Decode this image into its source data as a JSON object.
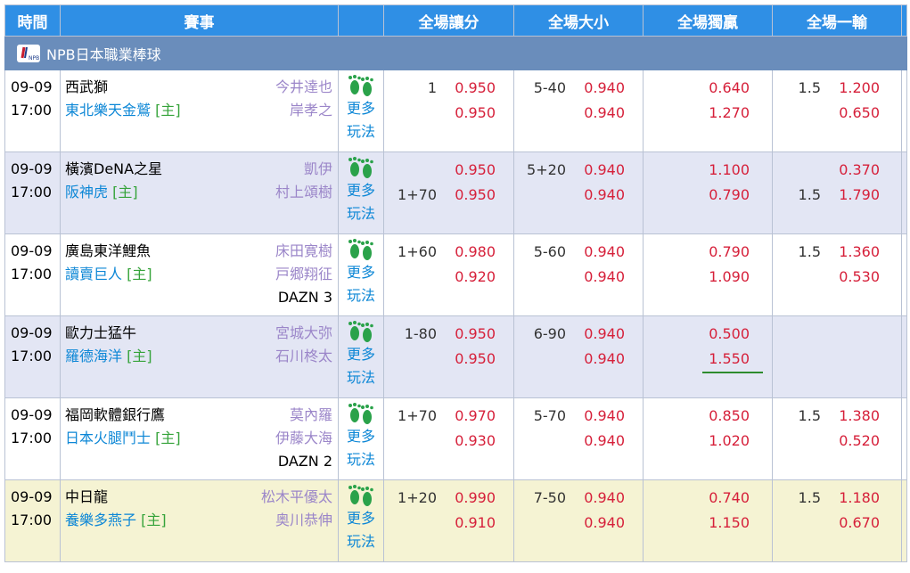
{
  "headers": {
    "time": "時間",
    "event": "賽事",
    "handicap": "全場讓分",
    "overunder": "全場大小",
    "moneyline": "全場獨贏",
    "onefive": "全場一輸"
  },
  "league": {
    "name": "NPB日本職業棒球",
    "logo_icon": "npb-logo-icon"
  },
  "colors": {
    "header_bg": "#2f8fe5",
    "league_bg": "#6a8dbb",
    "odds": "#d6203a",
    "home_team": "#0d87d6",
    "pitcher": "#9b86c9",
    "host_tag": "#35a33a"
  },
  "more_label_1": "更多",
  "more_label_2": "玩法",
  "more_icon": "footprints-icon",
  "matches": [
    {
      "date": "09-09",
      "time": "17:00",
      "away": "西武獅",
      "home": "東北樂天金鷲",
      "home_tag": "[主]",
      "away_pitcher": "今井達也",
      "home_pitcher": "岸孝之",
      "broadcast": "",
      "hdp": {
        "line1": "1",
        "val1": "0.950",
        "line2": "",
        "val2": "0.950"
      },
      "ou": {
        "line1": "5-40",
        "val1": "0.940",
        "line2": "",
        "val2": "0.940"
      },
      "ml": {
        "val1": "0.640",
        "val2": "1.270"
      },
      "rl": {
        "line1": "1.5",
        "val1": "1.200",
        "line2": "",
        "val2": "0.650"
      }
    },
    {
      "date": "09-09",
      "time": "17:00",
      "away": "橫濱DeNA之星",
      "home": "阪神虎",
      "home_tag": "[主]",
      "away_pitcher": "凱伊",
      "home_pitcher": "村上頌樹",
      "broadcast": "",
      "hdp": {
        "line1": "",
        "val1": "0.950",
        "line2": "1+70",
        "val2": "0.950"
      },
      "ou": {
        "line1": "5+20",
        "val1": "0.940",
        "line2": "",
        "val2": "0.940"
      },
      "ml": {
        "val1": "1.100",
        "val2": "0.790"
      },
      "rl": {
        "line1": "",
        "val1": "0.370",
        "line2": "1.5",
        "val2": "1.790"
      }
    },
    {
      "date": "09-09",
      "time": "17:00",
      "away": "廣島東洋鯉魚",
      "home": "讀賣巨人",
      "home_tag": "[主]",
      "away_pitcher": "床田寛樹",
      "home_pitcher": "戸郷翔征",
      "broadcast": "DAZN 3",
      "hdp": {
        "line1": "1+60",
        "val1": "0.980",
        "line2": "",
        "val2": "0.920"
      },
      "ou": {
        "line1": "5-60",
        "val1": "0.940",
        "line2": "",
        "val2": "0.940"
      },
      "ml": {
        "val1": "0.790",
        "val2": "1.090"
      },
      "rl": {
        "line1": "1.5",
        "val1": "1.360",
        "line2": "",
        "val2": "0.530"
      }
    },
    {
      "date": "09-09",
      "time": "17:00",
      "away": "歐力士猛牛",
      "home": "羅德海洋",
      "home_tag": "[主]",
      "away_pitcher": "宮城大弥",
      "home_pitcher": "石川柊太",
      "broadcast": "",
      "hdp": {
        "line1": "1-80",
        "val1": "0.950",
        "line2": "",
        "val2": "0.950"
      },
      "ou": {
        "line1": "6-90",
        "val1": "0.940",
        "line2": "",
        "val2": "0.940"
      },
      "ml": {
        "val1": "0.500",
        "val2": "1.550"
      },
      "rl": {
        "line1": "",
        "val1": "",
        "line2": "",
        "val2": ""
      }
    },
    {
      "date": "09-09",
      "time": "17:00",
      "away": "福岡軟體銀行鷹",
      "home": "日本火腿鬥士",
      "home_tag": "[主]",
      "away_pitcher": "莫內羅",
      "home_pitcher": "伊藤大海",
      "broadcast": "DAZN 2",
      "hdp": {
        "line1": "1+70",
        "val1": "0.970",
        "line2": "",
        "val2": "0.930"
      },
      "ou": {
        "line1": "5-70",
        "val1": "0.940",
        "line2": "",
        "val2": "0.940"
      },
      "ml": {
        "val1": "0.850",
        "val2": "1.020"
      },
      "rl": {
        "line1": "1.5",
        "val1": "1.380",
        "line2": "",
        "val2": "0.520"
      }
    },
    {
      "date": "09-09",
      "time": "17:00",
      "away": "中日龍",
      "home": "養樂多燕子",
      "home_tag": "[主]",
      "away_pitcher": "松木平優太",
      "home_pitcher": "奥川恭伸",
      "broadcast": "",
      "hdp": {
        "line1": "1+20",
        "val1": "0.990",
        "line2": "",
        "val2": "0.910"
      },
      "ou": {
        "line1": "7-50",
        "val1": "0.940",
        "line2": "",
        "val2": "0.940"
      },
      "ml": {
        "val1": "0.740",
        "val2": "1.150"
      },
      "rl": {
        "line1": "1.5",
        "val1": "1.180",
        "line2": "",
        "val2": "0.670"
      }
    }
  ]
}
